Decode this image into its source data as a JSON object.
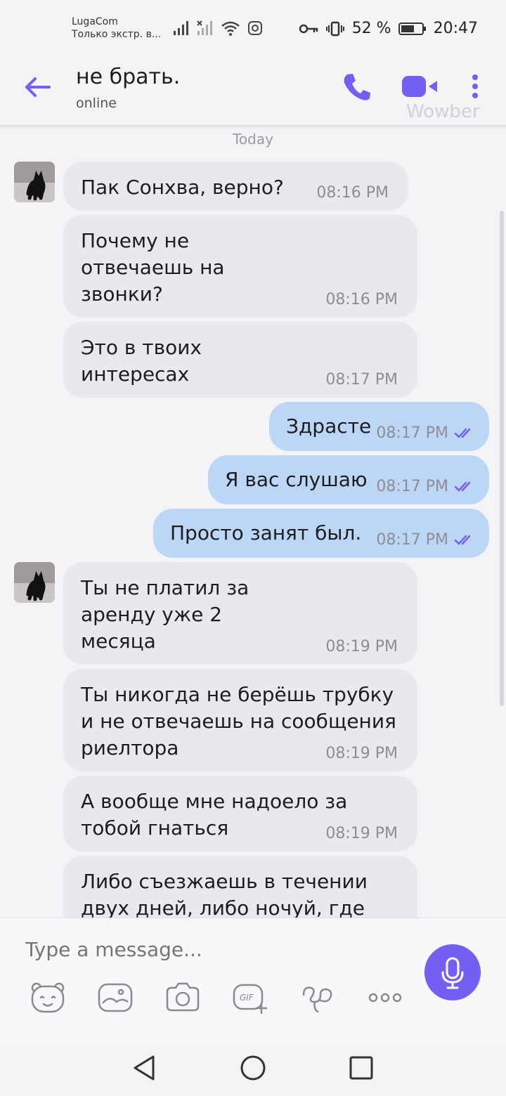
{
  "status_bar": {
    "carrier_name": "LugaCom",
    "carrier_sub": "Только экстр. в...",
    "battery": "52 %",
    "time": "20:47"
  },
  "header": {
    "title": "не брать.",
    "subtitle": "online",
    "watermark": "Wowber"
  },
  "chat": {
    "date_separator": "Today",
    "messages": [
      {
        "text": "Пак Сонхва, верно?",
        "time": "08:16 PM"
      },
      {
        "text": "Почему не\nотвечаешь на\nзвонки?",
        "time": "08:16 PM"
      },
      {
        "text": "Это в твоих\nинтересах",
        "time": "08:17 PM"
      },
      {
        "text": "Здрасте",
        "time": "08:17 PM"
      },
      {
        "text": "Я вас слушаю",
        "time": "08:17 PM"
      },
      {
        "text": "Просто занят был.",
        "time": "08:17 PM"
      },
      {
        "text": "Ты не платил за\nаренду уже 2\nмесяца",
        "time": "08:19 PM"
      },
      {
        "text": "Ты никогда не берёшь трубку\nи не отвечаешь на сообщения\nриелтора",
        "time": "08:19 PM"
      },
      {
        "text": "А вообще мне надоело за\nтобой гнаться",
        "time": "08:19 PM"
      },
      {
        "text": "Либо съезжаешь в течении\nдвух дней, либо ночуй, где",
        "time": ""
      }
    ]
  },
  "composer": {
    "placeholder": "Type a message..."
  },
  "colors": {
    "accent": "#7360f2",
    "incoming_bubble": "#e9e8ec",
    "outgoing_bubble": "#bcd7f6"
  }
}
